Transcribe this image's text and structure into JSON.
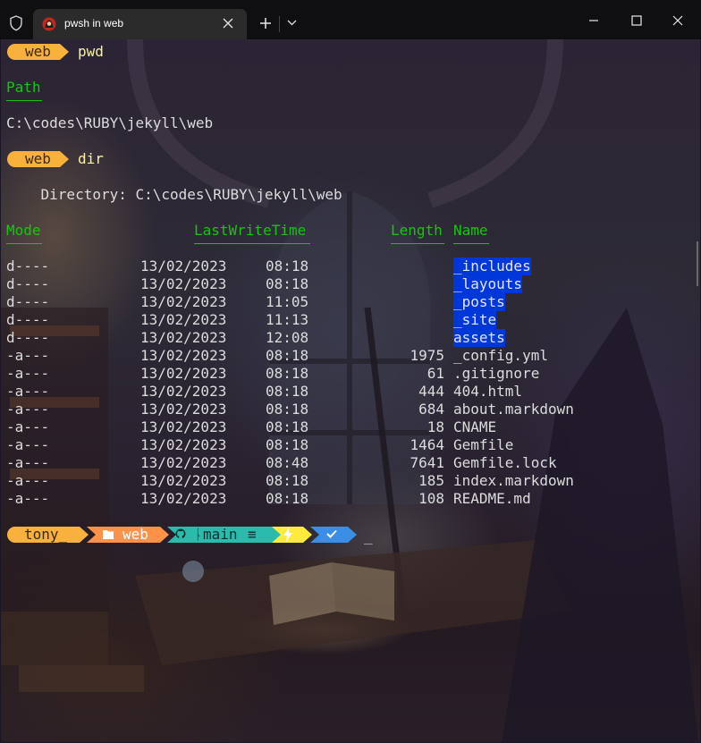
{
  "window": {
    "tab_title": "pwsh in web",
    "controls": {
      "minimize": "minimize-icon",
      "maximize": "maximize-icon",
      "close": "close-icon"
    }
  },
  "colors": {
    "prompt_yellow": "#f7b13c",
    "prompt_orange": "#ff9248",
    "git_teal": "#2bbbad",
    "lightning": "#ffeb3b",
    "check_blue": "#3a8ee6",
    "header_green": "#16c60c",
    "selection_blue": "#0037da"
  },
  "prompt1": {
    "dir": "web",
    "command": "pwd"
  },
  "pwd_output": {
    "header": "Path",
    "value": "C:\\codes\\RUBY\\jekyll\\web"
  },
  "prompt2": {
    "dir": "web",
    "command": "dir"
  },
  "dir_output": {
    "directory_label": "    Directory: C:\\codes\\RUBY\\jekyll\\web",
    "headers": {
      "mode": "Mode",
      "time": "LastWriteTime",
      "length": "Length",
      "name": "Name"
    },
    "rows": [
      {
        "mode": "d----",
        "date": "13/02/2023",
        "time": "08:18",
        "length": "",
        "name": "_includes"
      },
      {
        "mode": "d----",
        "date": "13/02/2023",
        "time": "08:18",
        "length": "",
        "name": "_layouts"
      },
      {
        "mode": "d----",
        "date": "13/02/2023",
        "time": "11:05",
        "length": "",
        "name": "_posts"
      },
      {
        "mode": "d----",
        "date": "13/02/2023",
        "time": "11:13",
        "length": "",
        "name": "_site"
      },
      {
        "mode": "d----",
        "date": "13/02/2023",
        "time": "12:08",
        "length": "",
        "name": "assets"
      },
      {
        "mode": "-a---",
        "date": "13/02/2023",
        "time": "08:18",
        "length": "1975",
        "name": "_config.yml"
      },
      {
        "mode": "-a---",
        "date": "13/02/2023",
        "time": "08:18",
        "length": "61",
        "name": ".gitignore"
      },
      {
        "mode": "-a---",
        "date": "13/02/2023",
        "time": "08:18",
        "length": "444",
        "name": "404.html"
      },
      {
        "mode": "-a---",
        "date": "13/02/2023",
        "time": "08:18",
        "length": "684",
        "name": "about.markdown"
      },
      {
        "mode": "-a---",
        "date": "13/02/2023",
        "time": "08:18",
        "length": "18",
        "name": "CNAME"
      },
      {
        "mode": "-a---",
        "date": "13/02/2023",
        "time": "08:18",
        "length": "1464",
        "name": "Gemfile"
      },
      {
        "mode": "-a---",
        "date": "13/02/2023",
        "time": "08:48",
        "length": "7641",
        "name": "Gemfile.lock"
      },
      {
        "mode": "-a---",
        "date": "13/02/2023",
        "time": "08:18",
        "length": "185",
        "name": "index.markdown"
      },
      {
        "mode": "-a---",
        "date": "13/02/2023",
        "time": "08:18",
        "length": "108",
        "name": "README.md"
      }
    ]
  },
  "prompt3": {
    "user": "tony_",
    "folder_icon": "folder-icon",
    "dir": "web",
    "git_icon": "github-icon",
    "branch": "main",
    "branch_status": "≡",
    "lightning_icon": "lightning-icon",
    "check_icon": "check-icon",
    "cursor": "_"
  }
}
